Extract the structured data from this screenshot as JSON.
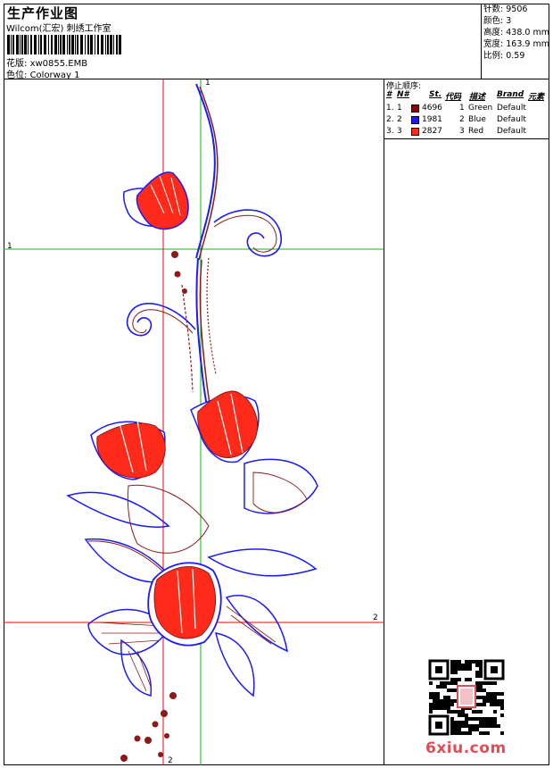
{
  "header": {
    "title": "生产作业图",
    "company": "Wilcom(汇宏) 刺绣工作室",
    "design_label": "花版:",
    "design_value": "xw0855.EMB",
    "colorway_label": "色位:",
    "colorway_value": "Colorway 1"
  },
  "stats": [
    {
      "label": "针数:",
      "value": "9506"
    },
    {
      "label": "颜色:",
      "value": "3"
    },
    {
      "label": "高度:",
      "value": "438.0 mm"
    },
    {
      "label": "宽度:",
      "value": "163.9 mm"
    },
    {
      "label": "比例:",
      "value": "0.59"
    }
  ],
  "stop_sequence": {
    "title": "停止顺序:",
    "headers": {
      "hash": "#",
      "num": "N#",
      "st": "St.",
      "code": "代码",
      "desc": "描述",
      "brand": "Brand",
      "element": "元素"
    },
    "rows": [
      {
        "hash": "1.",
        "num": "1",
        "color": "#8b0000",
        "st": "4696",
        "code": "1",
        "desc": "Green",
        "brand": "Default"
      },
      {
        "hash": "2.",
        "num": "2",
        "color": "#1a1aff",
        "st": "1981",
        "code": "2",
        "desc": "Blue",
        "brand": "Default"
      },
      {
        "hash": "3.",
        "num": "3",
        "color": "#ff2a1a",
        "st": "2827",
        "code": "3",
        "desc": "Red",
        "brand": "Default"
      }
    ]
  },
  "guides": {
    "green_label_1": "1",
    "red_label_2": "2",
    "top_label": "1",
    "bottom_label": "2"
  },
  "watermark": "6xiu.com",
  "colors": {
    "red_thread": "#ff2a1a",
    "blue_thread": "#1a1aff",
    "brown_thread": "#8b1a1a",
    "guide_red": "#ff0000",
    "guide_green": "#00c000"
  }
}
